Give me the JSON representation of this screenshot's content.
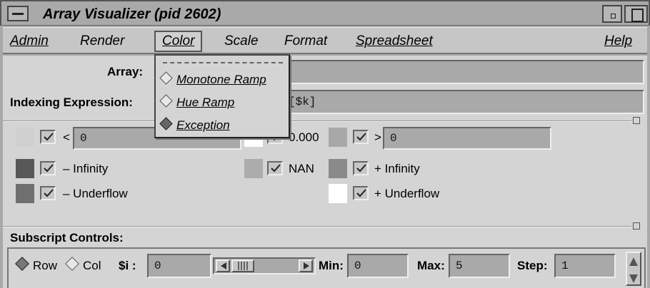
{
  "window": {
    "title": "Array Visualizer (pid 2602)"
  },
  "menubar": {
    "admin": "Admin",
    "render": "Render",
    "color": "Color",
    "scale": "Scale",
    "format": "Format",
    "spreadsheet": "Spreadsheet",
    "help": "Help"
  },
  "color_menu": {
    "items": [
      "Monotone Ramp",
      "Hue Ramp",
      "Exception"
    ],
    "selected": "Exception"
  },
  "form": {
    "array_label": "Array:",
    "array_value": "",
    "indexing_label": "Indexing Expression:",
    "indexing_value": "[$k]"
  },
  "colors": {
    "less_than_label": "<",
    "less_than_value": "0",
    "zero_value": "0.000",
    "greater_than_label": ">",
    "greater_than_value": "0",
    "neg_infinity": "– Infinity",
    "nan": "NAN",
    "pos_infinity": "+ Infinity",
    "neg_underflow": "– Underflow",
    "pos_underflow": "+ Underflow",
    "swatch_less": "#d0d0d0",
    "swatch_zero": "#ffffff",
    "swatch_greater": "#a8a8a8",
    "swatch_neg_infinity": "#585858",
    "swatch_nan": "#acacac",
    "swatch_pos_infinity": "#8a8a8a",
    "swatch_neg_underflow": "#6f6f6f",
    "swatch_pos_underflow": "#ffffff"
  },
  "subscript": {
    "title": "Subscript Controls:",
    "row_label": "Row",
    "col_label": "Col",
    "selected": "Row",
    "index_label": "$i :",
    "index_value": "0",
    "min_label": "Min:",
    "min_value": "0",
    "max_label": "Max:",
    "max_value": "5",
    "step_label": "Step:",
    "step_value": "1"
  }
}
